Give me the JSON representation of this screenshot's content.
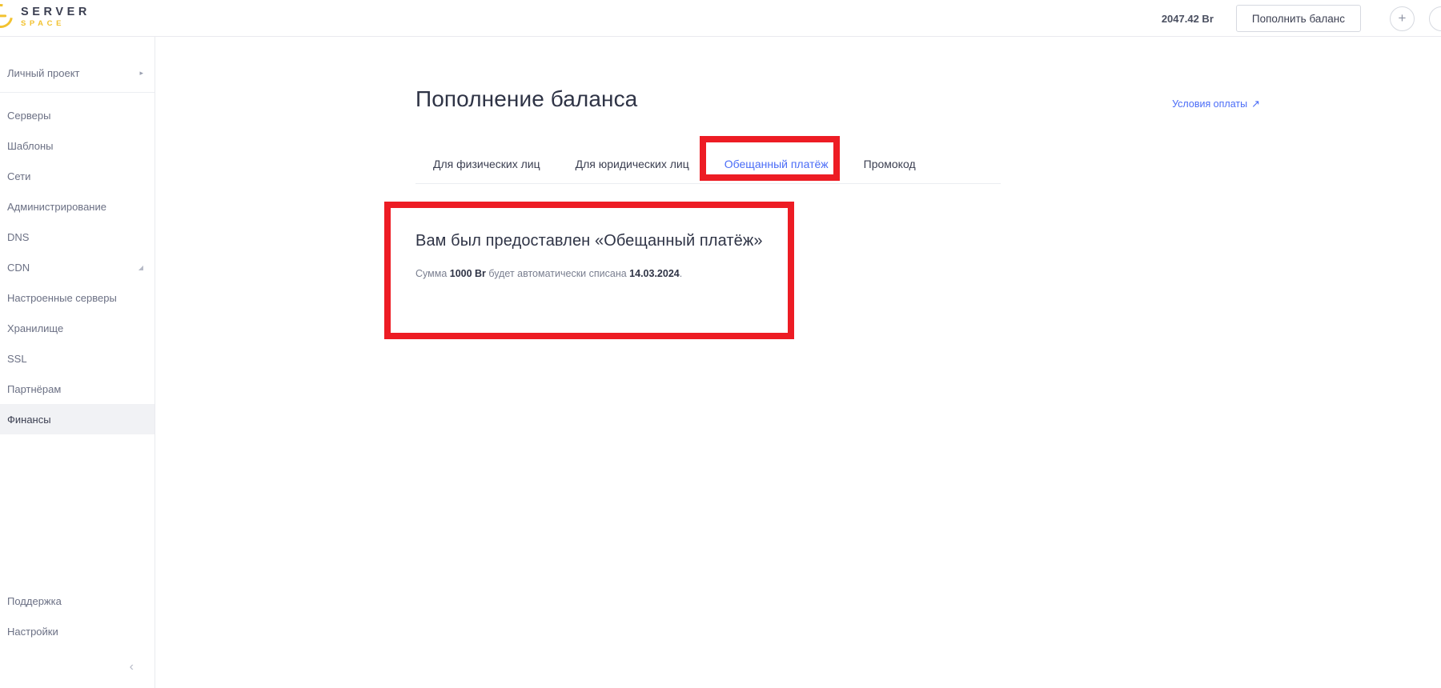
{
  "header": {
    "logo_top": "SERVER",
    "logo_bottom": "SPACE",
    "balance": "2047.42 Br",
    "topup_label": "Пополнить баланс",
    "plus_icon": "plus-icon",
    "edge_icon": "user-avatar-icon"
  },
  "sidebar": {
    "project": {
      "label": "Личный проект",
      "arrow": "▸"
    },
    "items": [
      {
        "label": "Серверы",
        "active": false,
        "caret": ""
      },
      {
        "label": "Шаблоны",
        "active": false,
        "caret": ""
      },
      {
        "label": "Сети",
        "active": false,
        "caret": ""
      },
      {
        "label": "Администрирование",
        "active": false,
        "caret": ""
      },
      {
        "label": "DNS",
        "active": false,
        "caret": ""
      },
      {
        "label": "CDN",
        "active": false,
        "caret": "◢"
      },
      {
        "label": "Настроенные серверы",
        "active": false,
        "caret": ""
      },
      {
        "label": "Хранилище",
        "active": false,
        "caret": ""
      },
      {
        "label": "SSL",
        "active": false,
        "caret": ""
      },
      {
        "label": "Партнёрам",
        "active": false,
        "caret": ""
      },
      {
        "label": "Финансы",
        "active": true,
        "caret": ""
      }
    ],
    "bottom_items": [
      {
        "label": "Поддержка"
      },
      {
        "label": "Настройки"
      }
    ],
    "collapse_icon": "‹"
  },
  "main": {
    "page_title": "Пополнение баланса",
    "terms_link": {
      "label": "Условия оплаты",
      "icon": "↗"
    },
    "tabs": [
      {
        "label": "Для физических лиц",
        "active": false
      },
      {
        "label": "Для юридических лиц",
        "active": false
      },
      {
        "label": "Обещанный платёж",
        "active": true
      },
      {
        "label": "Промокод",
        "active": false
      }
    ],
    "card": {
      "title": "Вам был предоставлен «Обещанный платёж»",
      "sub_prefix": "Сумма ",
      "sub_amount": "1000 Br",
      "sub_middle": " будет автоматически списана ",
      "sub_date": "14.03.2024",
      "sub_suffix": "."
    }
  },
  "annotations": {
    "color": "#ED1C24",
    "tab_box": "highlight-promised-payment-tab",
    "card_box": "highlight-promised-payment-card"
  }
}
